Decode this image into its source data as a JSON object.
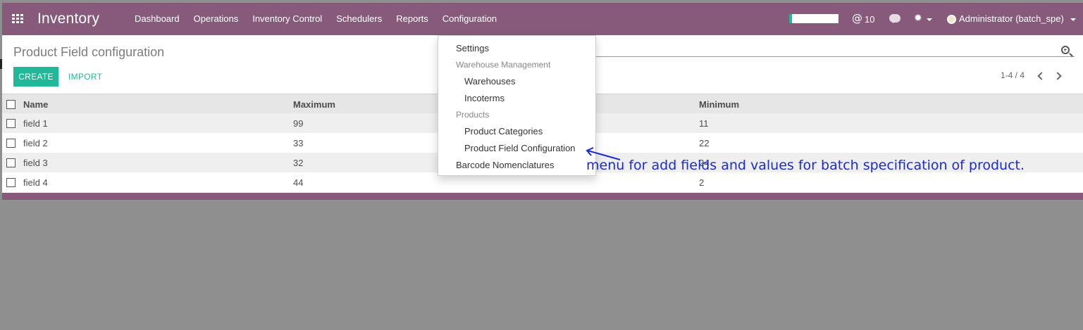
{
  "navbar": {
    "brand": "Inventory",
    "menu": [
      "Dashboard",
      "Operations",
      "Inventory Control",
      "Schedulers",
      "Reports",
      "Configuration"
    ],
    "mentions_count": "10",
    "user": "Administrator (batch_spe)"
  },
  "control_panel": {
    "title": "Product Field configuration",
    "create_label": "CREATE",
    "import_label": "IMPORT",
    "pager": "1-4 / 4"
  },
  "table": {
    "headers": {
      "name": "Name",
      "maximum": "Maximum",
      "minimum": "Minimum"
    },
    "rows": [
      {
        "name": "field 1",
        "maximum": "99",
        "minimum": "11"
      },
      {
        "name": "field 2",
        "maximum": "33",
        "minimum": "22"
      },
      {
        "name": "field 3",
        "maximum": "32",
        "minimum": "24"
      },
      {
        "name": "field 4",
        "maximum": "44",
        "minimum": "2"
      }
    ]
  },
  "config_menu": {
    "settings": "Settings",
    "warehouse_header": "Warehouse Management",
    "warehouses": "Warehouses",
    "incoterms": "Incoterms",
    "products_header": "Products",
    "product_categories": "Product Categories",
    "product_field_configuration": "Product Field Configuration",
    "barcode_nomenclatures": "Barcode Nomenclatures"
  },
  "annotation": "menu for add fields and values for batch specification of product.",
  "colors": {
    "navbar": "#875a7b",
    "accent": "#21b799",
    "annotation": "#1a2bd1",
    "backdrop": "#8f8f8f"
  },
  "icons": [
    "apps-grid-icon",
    "at-icon",
    "chat-icon",
    "bug-icon",
    "search-icon",
    "chevron-left-icon",
    "chevron-right-icon"
  ]
}
